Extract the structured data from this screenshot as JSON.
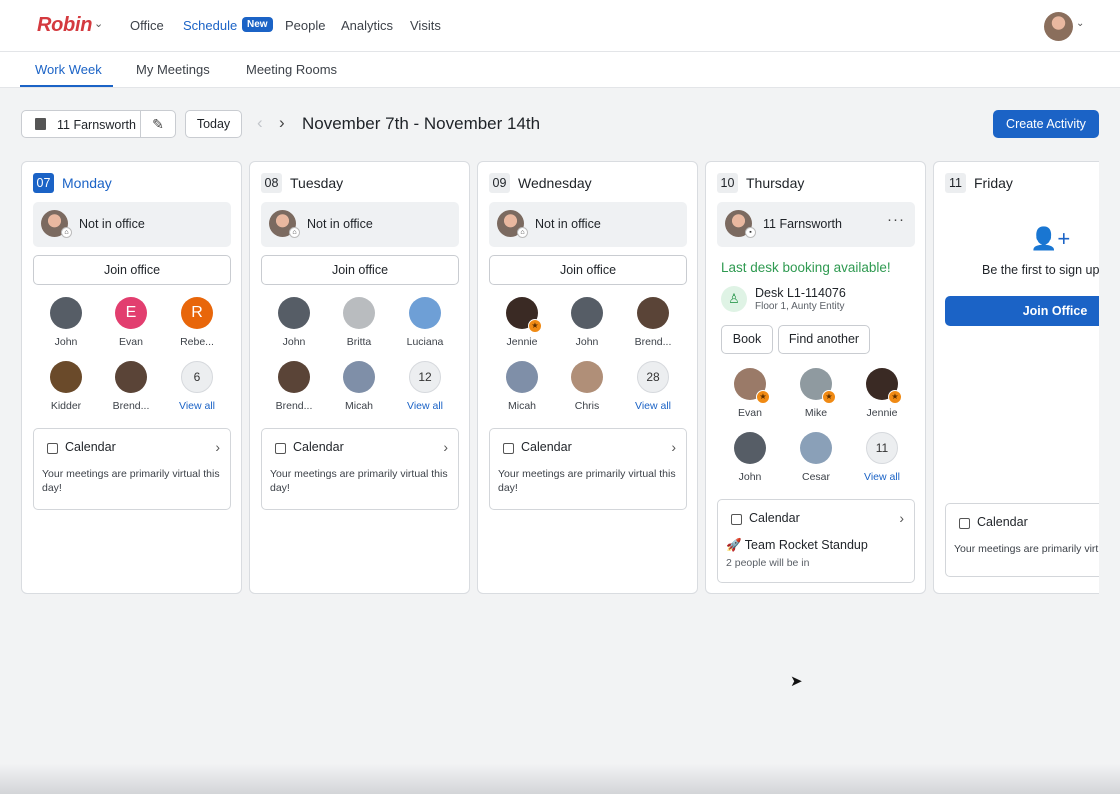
{
  "app": {
    "logo": "Robin",
    "logo_chevron": "⌄"
  },
  "nav": {
    "items": [
      {
        "label": "Office",
        "active": false
      },
      {
        "label": "Schedule",
        "active": true
      },
      {
        "label": "People",
        "active": false
      },
      {
        "label": "Analytics",
        "active": false
      },
      {
        "label": "Visits",
        "active": false
      }
    ],
    "badge": "New",
    "user_chevron": "⌄"
  },
  "tabs": [
    {
      "label": "Work Week",
      "active": true
    },
    {
      "label": "My Meetings",
      "active": false
    },
    {
      "label": "Meeting Rooms",
      "active": false
    }
  ],
  "toolbar": {
    "location": "11 Farnsworth",
    "edit_icon": "✎",
    "today": "Today",
    "prev": "‹",
    "next": "›",
    "date_range": "November 7th - November 14th",
    "create": "Create Activity"
  },
  "colors": {
    "accent": "#1b63c6",
    "success": "#2f9a51",
    "star": "#f08a14",
    "logo": "#d43a3f"
  },
  "days": [
    {
      "num": "07",
      "name": "Monday",
      "active": true,
      "status": "Not in office",
      "join": "Join office",
      "people": [
        {
          "name": "John",
          "color": "#565d66"
        },
        {
          "name": "Evan",
          "initial": "E",
          "color": "#e23e6f"
        },
        {
          "name": "Rebe...",
          "initial": "R",
          "color": "#e8660a"
        },
        {
          "name": "Kidder",
          "color": "#6a4a2a"
        },
        {
          "name": "Brend...",
          "color": "#5a4437"
        }
      ],
      "more_count": "6",
      "view_all": "View all",
      "calendar": {
        "title": "Calendar",
        "chevron": "›",
        "text": "Your meetings are primarily virtual this day!"
      }
    },
    {
      "num": "08",
      "name": "Tuesday",
      "active": false,
      "status": "Not in office",
      "join": "Join office",
      "people": [
        {
          "name": "John",
          "color": "#565d66"
        },
        {
          "name": "Britta",
          "color": "#b9bcbf"
        },
        {
          "name": "Luciana",
          "color": "#6e9fd6"
        },
        {
          "name": "Brend...",
          "color": "#5a4437"
        },
        {
          "name": "Micah",
          "color": "#7f8fa8"
        }
      ],
      "more_count": "12",
      "view_all": "View all",
      "calendar": {
        "title": "Calendar",
        "chevron": "›",
        "text": "Your meetings are primarily virtual this day!"
      }
    },
    {
      "num": "09",
      "name": "Wednesday",
      "active": false,
      "status": "Not in office",
      "join": "Join office",
      "people": [
        {
          "name": "Jennie",
          "color": "#3a2a24",
          "star": "★"
        },
        {
          "name": "John",
          "color": "#565d66"
        },
        {
          "name": "Brend...",
          "color": "#5a4437"
        },
        {
          "name": "Micah",
          "color": "#7f8fa8"
        },
        {
          "name": "Chris",
          "color": "#b08f78"
        }
      ],
      "more_count": "28",
      "view_all": "View all",
      "calendar": {
        "title": "Calendar",
        "chevron": "›",
        "text": "Your meetings are primarily virtual this day!"
      }
    },
    {
      "num": "10",
      "name": "Thursday",
      "active": false,
      "status": "11 Farnsworth",
      "menu": "···",
      "notice": "Last desk booking available!",
      "desk": {
        "icon": "♙",
        "title": "Desk L1-114076",
        "sub": "Floor 1, Aunty Entity"
      },
      "book": "Book",
      "find_another": "Find another",
      "people": [
        {
          "name": "Evan",
          "color": "#9a7a68",
          "star": "★"
        },
        {
          "name": "Mike",
          "color": "#8f9aa0",
          "star": "★"
        },
        {
          "name": "Jennie",
          "color": "#3a2a24",
          "star": "★"
        },
        {
          "name": "John",
          "color": "#565d66"
        },
        {
          "name": "Cesar",
          "color": "#8aa0b8"
        }
      ],
      "more_count": "11",
      "view_all": "View all",
      "calendar": {
        "title": "Calendar",
        "chevron": "›",
        "meeting": "🚀 Team Rocket Standup",
        "meeting_sub": "2 people will be in"
      }
    },
    {
      "num": "11",
      "name": "Friday",
      "active": false,
      "add_icon": "👤+",
      "first": "Be the first to sign up",
      "join": "Join Office",
      "calendar": {
        "title": "Calendar",
        "text": "Your meetings are primarily virtual this day!"
      }
    }
  ],
  "cursor": "➤"
}
